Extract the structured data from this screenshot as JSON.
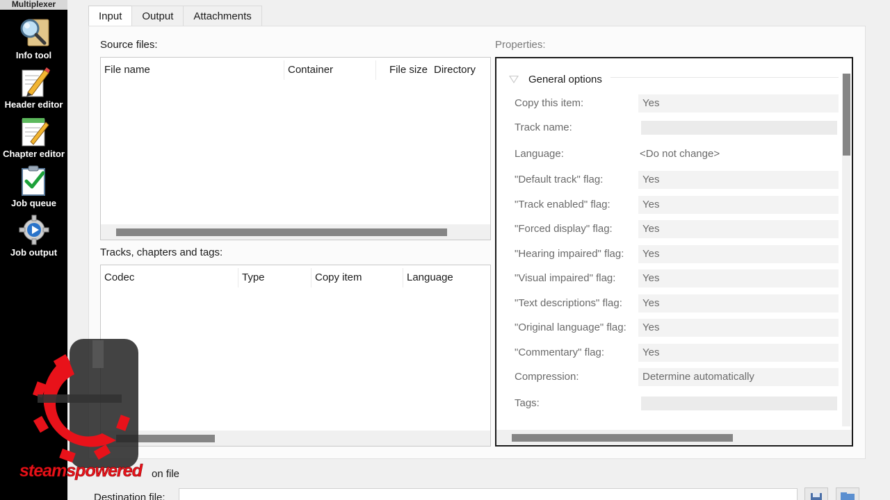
{
  "sidebar": {
    "title": "Multiplexer",
    "items": [
      {
        "label": "Info tool",
        "icon": "magnifier-icon"
      },
      {
        "label": "Header editor",
        "icon": "pencil-paper-icon"
      },
      {
        "label": "Chapter editor",
        "icon": "notepad-icon"
      },
      {
        "label": "Job queue",
        "icon": "checklist-icon"
      },
      {
        "label": "Job output",
        "icon": "gear-play-icon"
      }
    ]
  },
  "tabs": [
    {
      "label": "Input"
    },
    {
      "label": "Output"
    },
    {
      "label": "Attachments"
    }
  ],
  "source_files": {
    "label": "Source files:",
    "columns": [
      "File name",
      "Container",
      "File size",
      "Directory"
    ]
  },
  "tracks": {
    "label": "Tracks, chapters and tags:",
    "columns": [
      "Codec",
      "Type",
      "Copy item",
      "Language"
    ]
  },
  "properties": {
    "label": "Properties:",
    "group_title": "General options",
    "rows": [
      {
        "key": "Copy this item:",
        "value": "Yes"
      },
      {
        "key": "Track name:",
        "value": ""
      },
      {
        "key": "Language:",
        "value": "<Do not change>"
      },
      {
        "key": "\"Default track\" flag:",
        "value": "Yes"
      },
      {
        "key": "\"Track enabled\" flag:",
        "value": "Yes"
      },
      {
        "key": "\"Forced display\" flag:",
        "value": "Yes"
      },
      {
        "key": "\"Hearing impaired\" flag:",
        "value": "Yes"
      },
      {
        "key": "\"Visual impaired\" flag:",
        "value": "Yes"
      },
      {
        "key": "\"Text descriptions\" flag:",
        "value": "Yes"
      },
      {
        "key": "\"Original language\" flag:",
        "value": "Yes"
      },
      {
        "key": "\"Commentary\" flag:",
        "value": "Yes"
      },
      {
        "key": "Compression:",
        "value": "Determine automatically"
      },
      {
        "key": "Tags:",
        "value": ""
      }
    ]
  },
  "destination": {
    "title": "on file",
    "label": "Destination file:",
    "value": ""
  },
  "watermark": {
    "text": "steamspowered"
  },
  "colors": {
    "sidebar_bg": "#000000",
    "watermark_red": "#e8121a",
    "scroll_thumb": "#858585"
  }
}
